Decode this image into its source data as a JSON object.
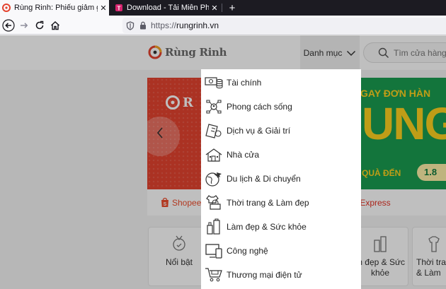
{
  "browser": {
    "tabs": [
      {
        "title": "Rùng Rinh: Phiếu giảm giá, Ch",
        "active": true
      },
      {
        "title": "Download - Tải Miễn Phí VN - P",
        "active": false
      }
    ],
    "close_glyph": "✕",
    "new_tab_glyph": "+",
    "url_scheme": "https://",
    "url_host": "rungrinh.vn"
  },
  "header": {
    "logo_text": "Rùng Rinh",
    "menu_button_label": "Danh mục",
    "search_placeholder": "Tìm cửa hàng"
  },
  "banner": {
    "left_brand": "R",
    "right_topline": "GAY ĐƠN HÀN",
    "right_big": "UNG",
    "right_bottomline": "QUÀ ĐẾN",
    "right_pill": "1.8",
    "stores": [
      "Shopee",
      "liExpress"
    ]
  },
  "categories_row": [
    {
      "label": "Nổi bật",
      "icon": "medal-icon"
    },
    {
      "label": "m đẹp & Sức khỏe",
      "icon": "cosmetics-icon"
    },
    {
      "label": "Thời tran & Làm",
      "icon": "fashion-icon"
    }
  ],
  "dropdown": {
    "items": [
      {
        "label": "Tài chính",
        "icon": "money-icon"
      },
      {
        "label": "Phong cách sống",
        "icon": "lifestyle-icon"
      },
      {
        "label": "Dịch vụ & Giải trí",
        "icon": "ticket-icon"
      },
      {
        "label": "Nhà cửa",
        "icon": "house-icon"
      },
      {
        "label": "Du lịch & Di chuyển",
        "icon": "globe-plane-icon"
      },
      {
        "label": "Thời trang & Làm đẹp",
        "icon": "clothing-icon"
      },
      {
        "label": "Làm đẹp & Sức khỏe",
        "icon": "cosmetics-icon"
      },
      {
        "label": "Công nghệ",
        "icon": "devices-icon"
      },
      {
        "label": "Thương mại điện tử",
        "icon": "cart-icon"
      }
    ]
  },
  "colors": {
    "brand_orange": "#e4432f",
    "promo_green": "#1a9d50",
    "promo_yellow": "#ffd21f"
  }
}
